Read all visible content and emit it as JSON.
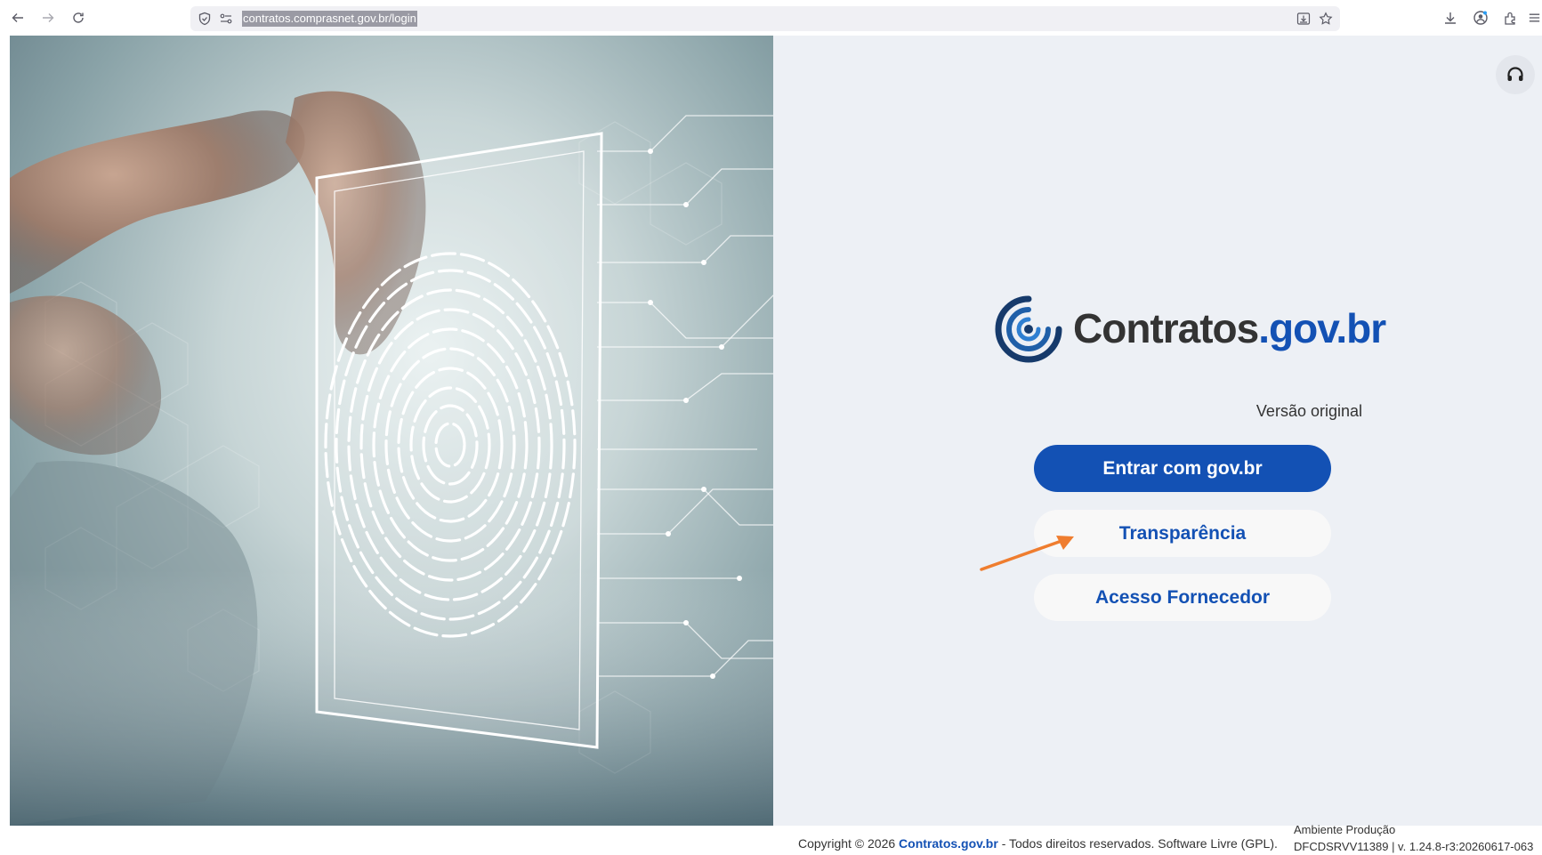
{
  "browser": {
    "url": "contratos.comprasnet.gov.br/login"
  },
  "brand": {
    "name_main": "Contratos",
    "name_suffix": ".gov.br",
    "version_label": "Versão original",
    "primary_color": "#1351b4",
    "logo_icon": "contratos-logo-icon"
  },
  "actions": {
    "login_label": "Entrar com gov.br",
    "transparency_label": "Transparência",
    "supplier_label": "Acesso Fornecedor"
  },
  "support": {
    "icon": "headset-icon"
  },
  "footer": {
    "copyright_prefix": "Copyright © 2026",
    "brand_link": "Contratos.gov.br",
    "copyright_suffix": "- Todos direitos reservados. Software Livre (GPL).",
    "environment": "Ambiente Produção",
    "build": "DFCDSRVV11389 | v. 1.24.8-r3:20260617-063"
  },
  "annotation": {
    "arrow_color": "#ef7d2f"
  }
}
